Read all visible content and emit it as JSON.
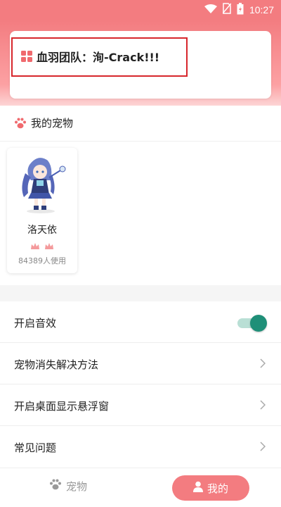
{
  "status_bar": {
    "time": "10:27",
    "icons": [
      "wifi-icon",
      "sim-off-icon",
      "battery-icon"
    ]
  },
  "team_banner": {
    "text": "血羽团队：洵-Crack!!!",
    "icon": "grid-icon"
  },
  "pets": {
    "title": "我的宠物",
    "items": [
      {
        "name": "洛天依",
        "usage": "84389人使用",
        "badges": 2
      }
    ]
  },
  "settings": {
    "sound": {
      "label": "开启音效",
      "enabled": true
    },
    "items": [
      {
        "label": "宠物消失解决方法"
      },
      {
        "label": "开启桌面显示悬浮窗"
      },
      {
        "label": "常见问题"
      }
    ]
  },
  "nav": {
    "pets_label": "宠物",
    "mine_label": "我的",
    "active": "mine"
  },
  "colors": {
    "accent": "#f37c80",
    "toggle_on": "#1f8f78",
    "highlight_border": "#d7262c"
  }
}
